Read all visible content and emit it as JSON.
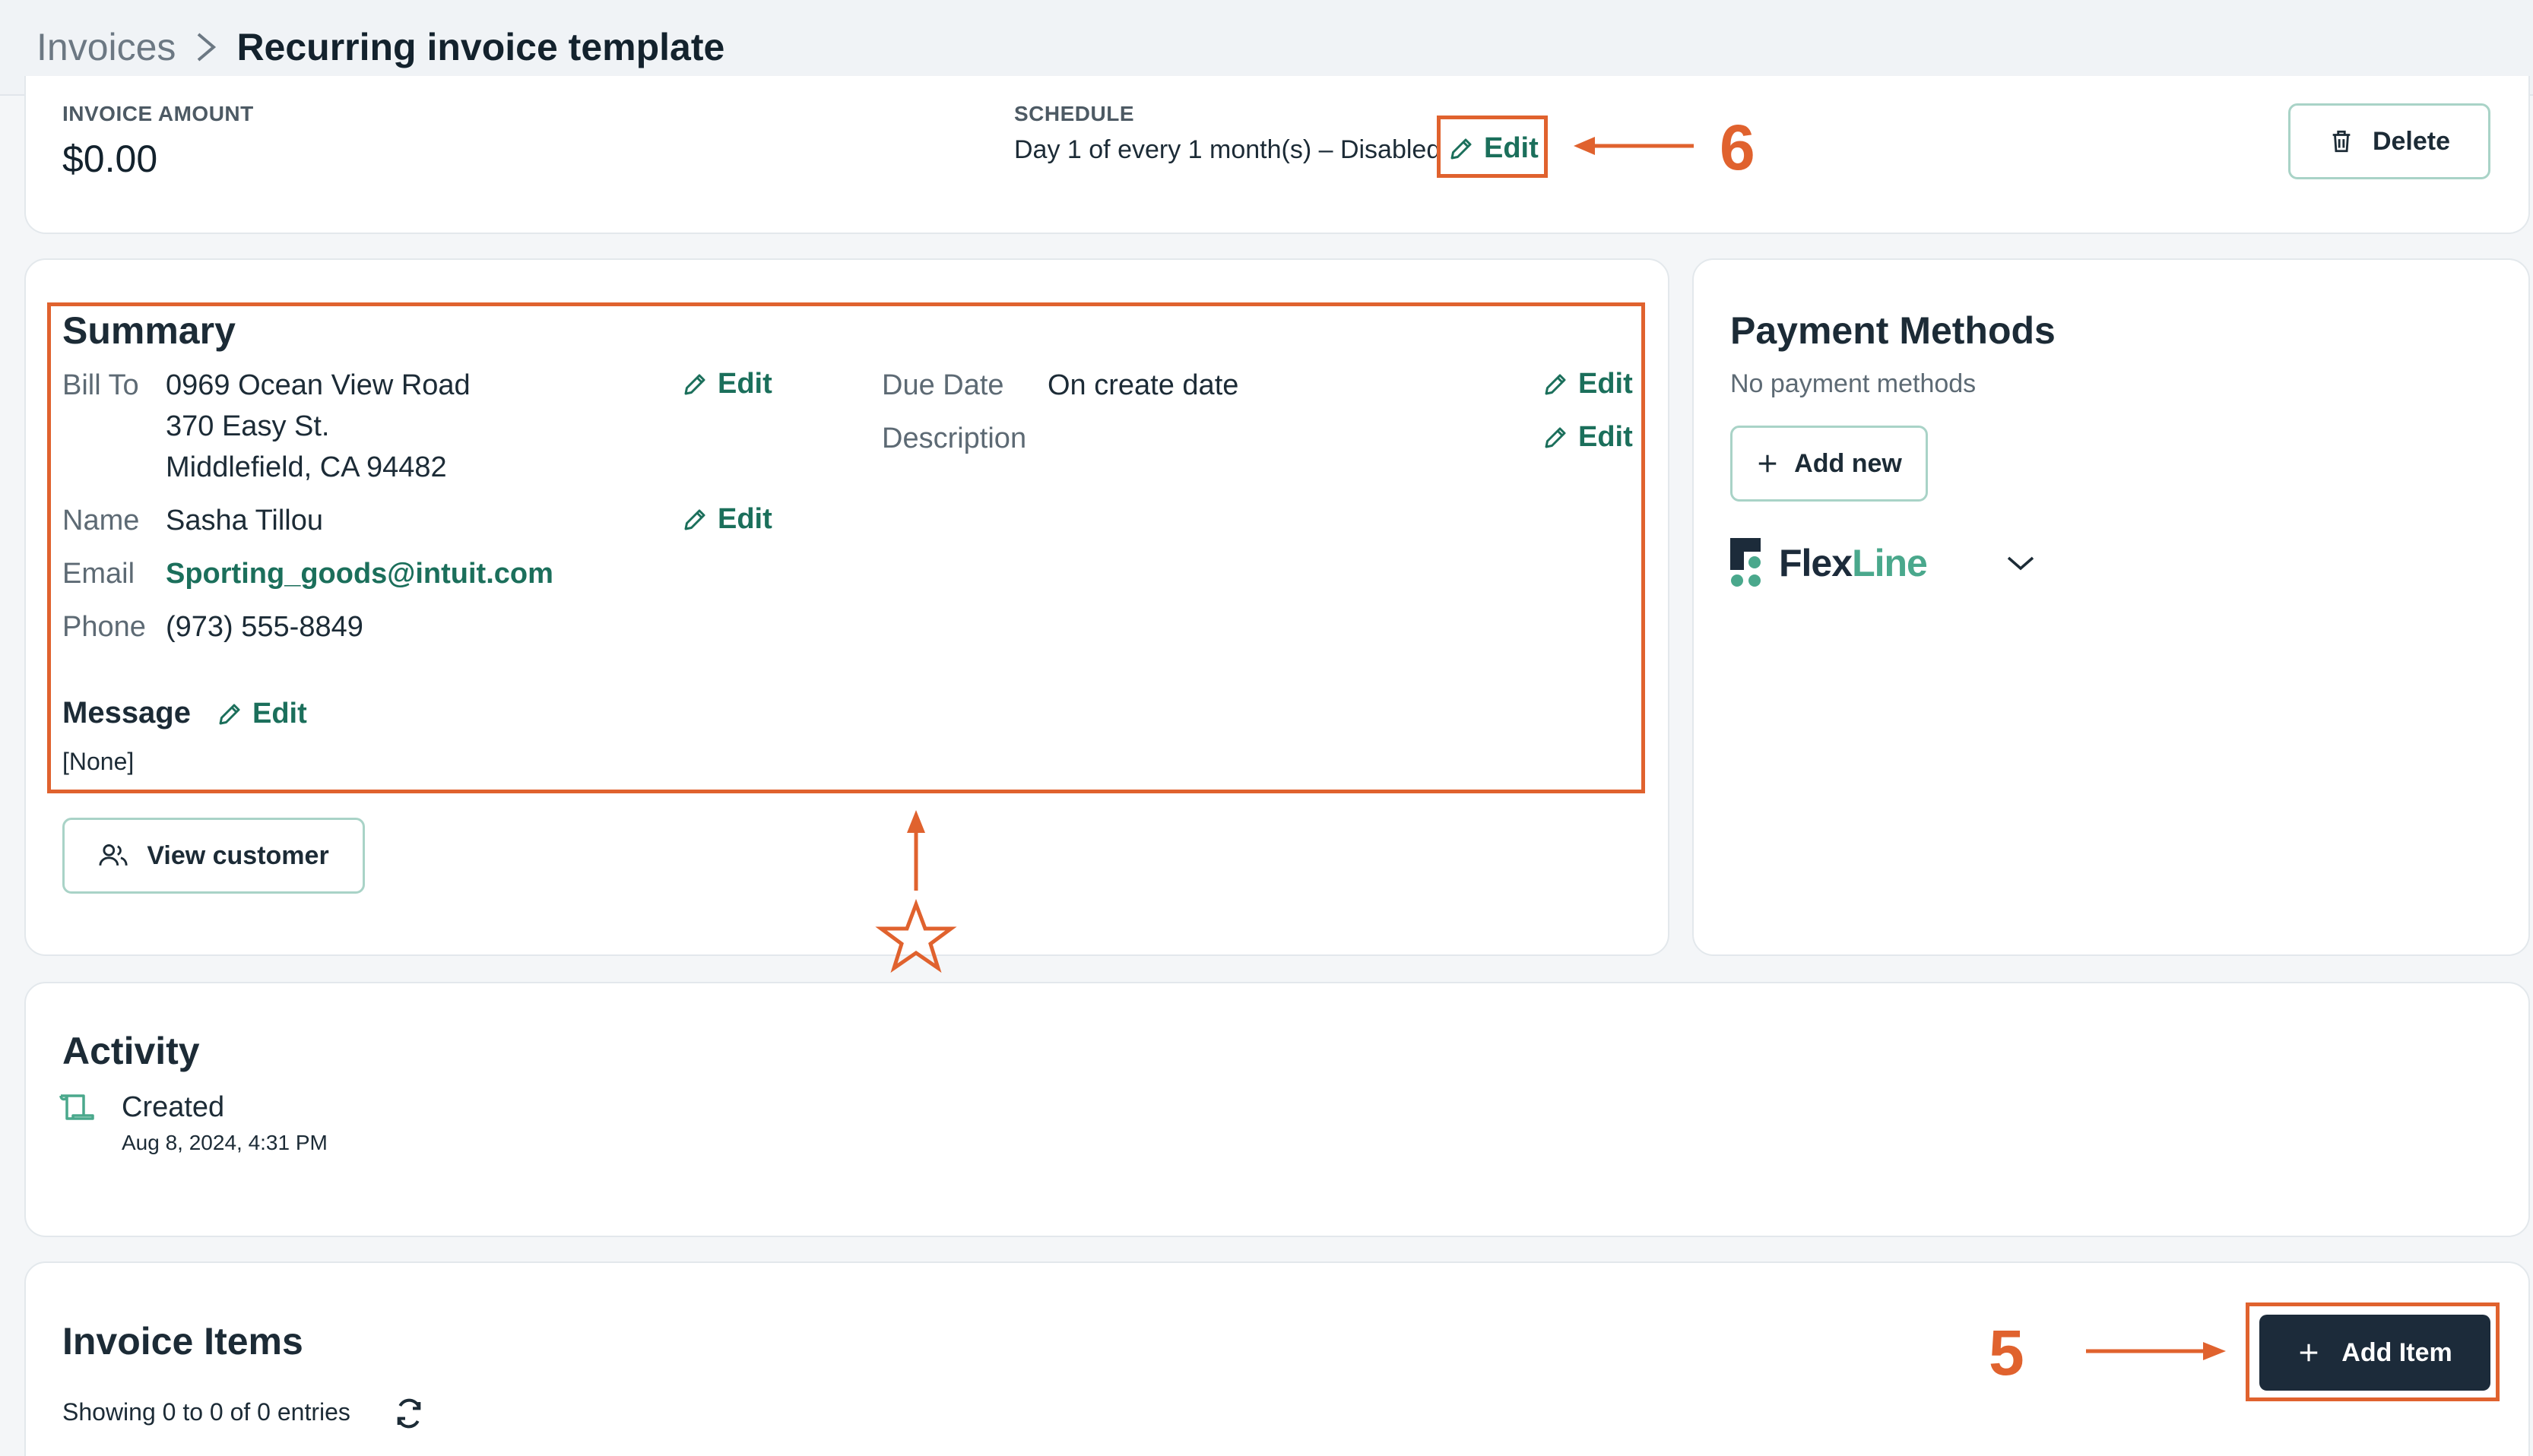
{
  "breadcrumb": {
    "parent": "Invoices",
    "current": "Recurring invoice template"
  },
  "top_card": {
    "amount_label": "INVOICE AMOUNT",
    "amount_value": "$0.00",
    "schedule_label": "SCHEDULE",
    "schedule_value": "Day 1 of every 1 month(s) – Disabled",
    "edit_label": "Edit",
    "delete_label": "Delete"
  },
  "summary": {
    "title": "Summary",
    "bill_to_label": "Bill To",
    "bill_to_lines": [
      "0969 Ocean View Road",
      "370 Easy St.",
      "Middlefield, CA 94482"
    ],
    "name_label": "Name",
    "name_value": "Sasha Tillou",
    "email_label": "Email",
    "email_value": "Sporting_goods@intuit.com",
    "phone_label": "Phone",
    "phone_value": "(973) 555-8849",
    "due_date_label": "Due Date",
    "due_date_value": "On create date",
    "description_label": "Description",
    "edit_label": "Edit",
    "message_title": "Message",
    "message_value": "[None]",
    "view_customer_label": "View customer"
  },
  "payment_methods": {
    "title": "Payment Methods",
    "empty_text": "No payment methods",
    "add_new_label": "Add new",
    "provider_part1": "Flex",
    "provider_part2": "Line"
  },
  "activity": {
    "title": "Activity",
    "items": [
      {
        "event": "Created",
        "timestamp": "Aug 8, 2024, 4:31 PM"
      }
    ]
  },
  "invoice_items": {
    "title": "Invoice Items",
    "showing_text": "Showing 0 to 0 of 0 entries",
    "add_item_label": "Add Item"
  },
  "annotations": {
    "schedule_edit_number": "6",
    "add_item_number": "5"
  },
  "colors": {
    "accent": "#1b6f5b",
    "annotation": "#e0622e",
    "dark_button": "#1c2b3a"
  }
}
